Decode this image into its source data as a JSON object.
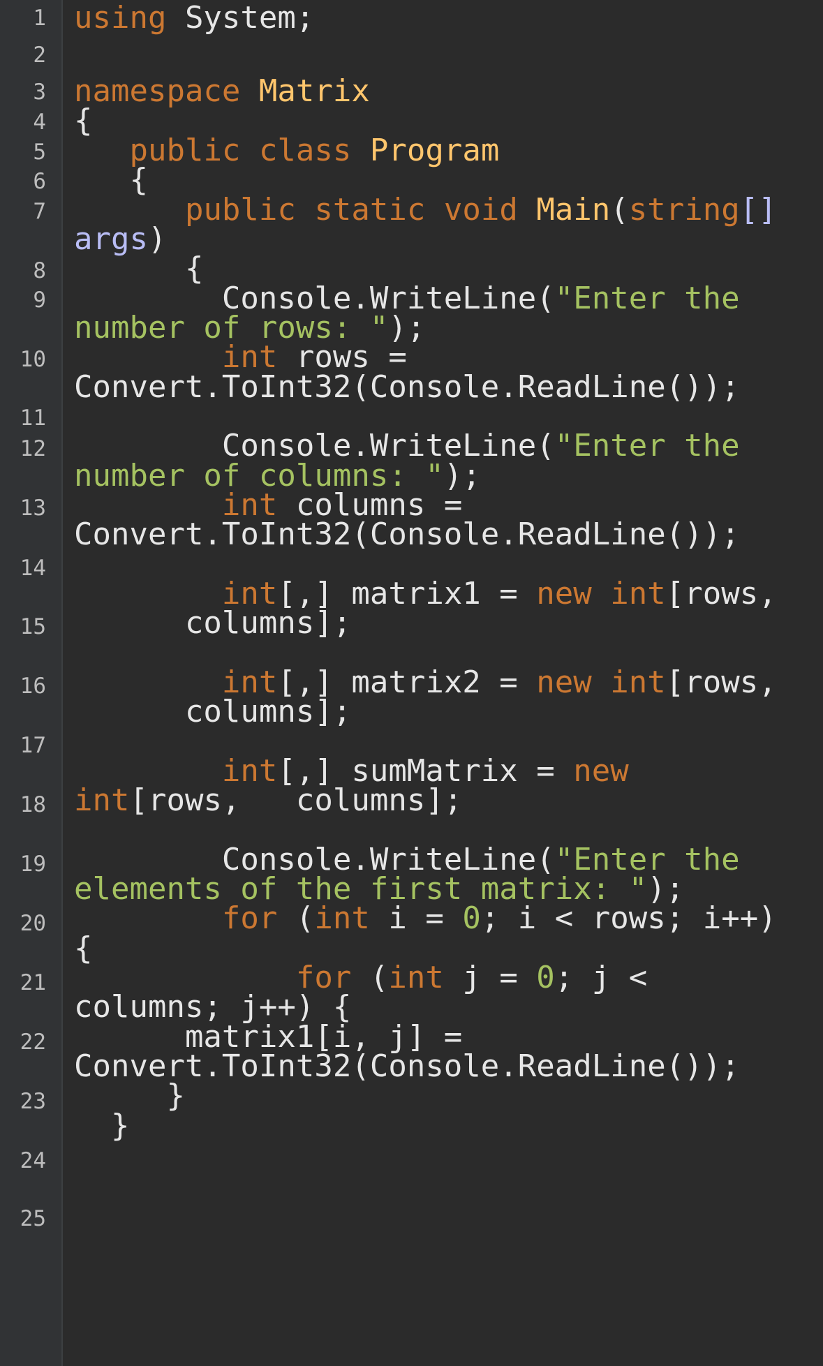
{
  "editor": {
    "language": "C#",
    "colors": {
      "background": "#2b2b2b",
      "gutter_background": "#313335",
      "line_number": "#bdbdbd",
      "keyword": "#cc7832",
      "type_name": "#ffc66d",
      "string": "#a5c261",
      "number": "#a5c261",
      "parameter": "#b9bdf5",
      "text": "#e6e6e6"
    },
    "line_numbers": [
      "1",
      "2",
      "3",
      "4",
      "5",
      "6",
      "7",
      "8",
      "9",
      "10",
      "11",
      "12",
      "13",
      "14",
      "15",
      "16",
      "17",
      "18",
      "19",
      "20",
      "21",
      "22",
      "23",
      "24",
      "25"
    ],
    "lines": [
      [
        {
          "t": "using",
          "c": "kw"
        },
        {
          "t": " System;",
          "c": "tx"
        }
      ],
      [],
      [
        {
          "t": "namespace",
          "c": "kw"
        },
        {
          "t": " ",
          "c": "tx"
        },
        {
          "t": "Matrix",
          "c": "ty"
        }
      ],
      [
        {
          "t": "{",
          "c": "tx"
        }
      ],
      [
        {
          "t": "   ",
          "c": "tx"
        },
        {
          "t": "public",
          "c": "kw"
        },
        {
          "t": " ",
          "c": "tx"
        },
        {
          "t": "class",
          "c": "kw"
        },
        {
          "t": " ",
          "c": "tx"
        },
        {
          "t": "Program",
          "c": "ty"
        }
      ],
      [
        {
          "t": "   {",
          "c": "tx"
        }
      ],
      [
        {
          "t": "      ",
          "c": "tx"
        },
        {
          "t": "public",
          "c": "kw"
        },
        {
          "t": " ",
          "c": "tx"
        },
        {
          "t": "static",
          "c": "kw"
        },
        {
          "t": " ",
          "c": "tx"
        },
        {
          "t": "void",
          "c": "kw"
        },
        {
          "t": " ",
          "c": "tx"
        },
        {
          "t": "Main",
          "c": "ty"
        },
        {
          "t": "(",
          "c": "tx"
        },
        {
          "t": "string",
          "c": "kw"
        },
        {
          "t": "[]",
          "c": "pr"
        }
      ],
      [
        {
          "t": "args",
          "c": "pr"
        },
        {
          "t": ")",
          "c": "tx"
        }
      ],
      [
        {
          "t": "      {",
          "c": "tx"
        }
      ],
      [
        {
          "t": "        Console.WriteLine(",
          "c": "tx"
        },
        {
          "t": "\"Enter the",
          "c": "st"
        }
      ],
      [
        {
          "t": "number of rows: \"",
          "c": "st"
        },
        {
          "t": ");",
          "c": "tx"
        }
      ],
      [
        {
          "t": "        ",
          "c": "tx"
        },
        {
          "t": "int",
          "c": "kw"
        },
        {
          "t": " rows =",
          "c": "tx"
        }
      ],
      [
        {
          "t": "Convert.ToInt32(Console.ReadLine());",
          "c": "tx"
        }
      ],
      [],
      [
        {
          "t": "        Console.WriteLine(",
          "c": "tx"
        },
        {
          "t": "\"Enter the",
          "c": "st"
        }
      ],
      [
        {
          "t": "number of columns: \"",
          "c": "st"
        },
        {
          "t": ");",
          "c": "tx"
        }
      ],
      [
        {
          "t": "        ",
          "c": "tx"
        },
        {
          "t": "int",
          "c": "kw"
        },
        {
          "t": " columns =",
          "c": "tx"
        }
      ],
      [
        {
          "t": "Convert.ToInt32(Console.ReadLine());",
          "c": "tx"
        }
      ],
      [],
      [
        {
          "t": "        ",
          "c": "tx"
        },
        {
          "t": "int",
          "c": "kw"
        },
        {
          "t": "[,] matrix1 = ",
          "c": "tx"
        },
        {
          "t": "new",
          "c": "kw"
        },
        {
          "t": " ",
          "c": "tx"
        },
        {
          "t": "int",
          "c": "kw"
        },
        {
          "t": "[rows,",
          "c": "tx"
        }
      ],
      [
        {
          "t": "      columns];",
          "c": "tx"
        }
      ],
      [],
      [
        {
          "t": "        ",
          "c": "tx"
        },
        {
          "t": "int",
          "c": "kw"
        },
        {
          "t": "[,] matrix2 = ",
          "c": "tx"
        },
        {
          "t": "new",
          "c": "kw"
        },
        {
          "t": " ",
          "c": "tx"
        },
        {
          "t": "int",
          "c": "kw"
        },
        {
          "t": "[rows,",
          "c": "tx"
        }
      ],
      [
        {
          "t": "      columns];",
          "c": "tx"
        }
      ],
      [],
      [
        {
          "t": "        ",
          "c": "tx"
        },
        {
          "t": "int",
          "c": "kw"
        },
        {
          "t": "[,] sumMatrix = ",
          "c": "tx"
        },
        {
          "t": "new",
          "c": "kw"
        }
      ],
      [
        {
          "t": "int",
          "c": "kw"
        },
        {
          "t": "[rows,   columns];",
          "c": "tx"
        }
      ],
      [],
      [
        {
          "t": "        Console.WriteLine(",
          "c": "tx"
        },
        {
          "t": "\"Enter the",
          "c": "st"
        }
      ],
      [
        {
          "t": "elements of the first matrix: \"",
          "c": "st"
        },
        {
          "t": ");",
          "c": "tx"
        }
      ],
      [
        {
          "t": "        ",
          "c": "tx"
        },
        {
          "t": "for",
          "c": "kw"
        },
        {
          "t": " (",
          "c": "tx"
        },
        {
          "t": "int",
          "c": "kw"
        },
        {
          "t": " i = ",
          "c": "tx"
        },
        {
          "t": "0",
          "c": "nu"
        },
        {
          "t": "; i < rows; i++)",
          "c": "tx"
        }
      ],
      [
        {
          "t": "{",
          "c": "tx"
        }
      ],
      [
        {
          "t": "            ",
          "c": "tx"
        },
        {
          "t": "for",
          "c": "kw"
        },
        {
          "t": " (",
          "c": "tx"
        },
        {
          "t": "int",
          "c": "kw"
        },
        {
          "t": " j = ",
          "c": "tx"
        },
        {
          "t": "0",
          "c": "nu"
        },
        {
          "t": "; j <",
          "c": "tx"
        }
      ],
      [
        {
          "t": "columns; j++) {",
          "c": "tx"
        }
      ],
      [
        {
          "t": "      matrix1[i, j] =",
          "c": "tx"
        }
      ],
      [
        {
          "t": "Convert.ToInt32(Console.ReadLine());",
          "c": "tx"
        }
      ],
      [
        {
          "t": "     }",
          "c": "tx"
        }
      ],
      [
        {
          "t": "  }",
          "c": "tx"
        }
      ]
    ]
  }
}
